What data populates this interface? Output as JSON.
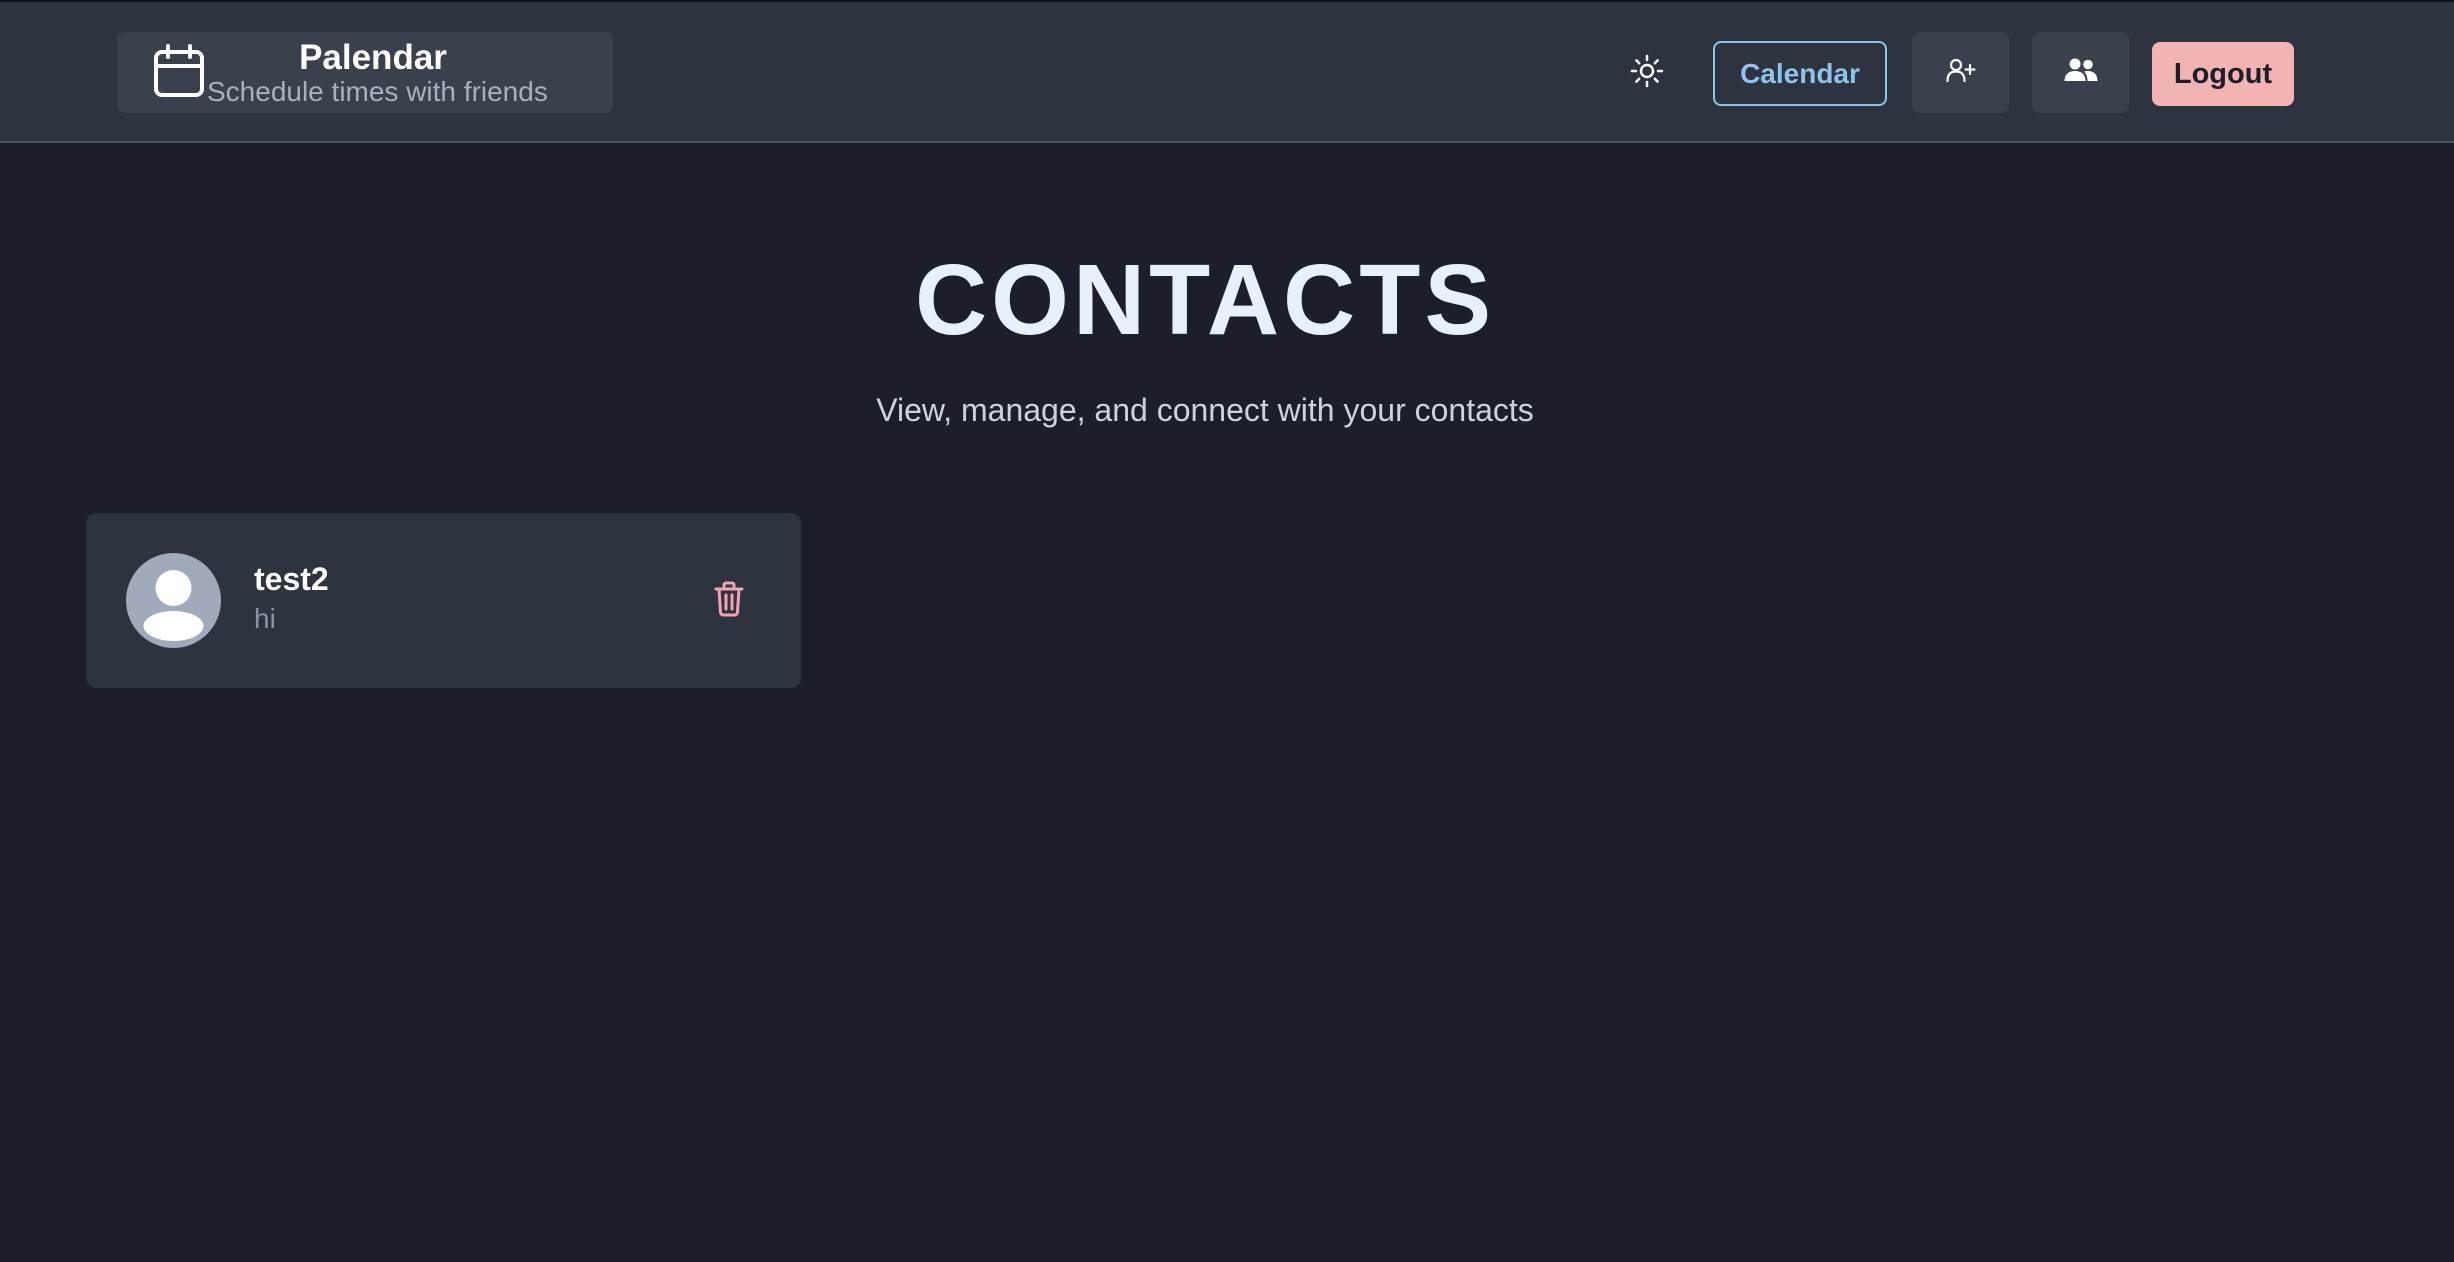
{
  "header": {
    "brand_icon": "calendar-icon",
    "app_name": "Palendar",
    "tagline": "Schedule times with friends",
    "theme_toggle_icon": "sun-icon",
    "calendar_label": "Calendar",
    "add_contact_icon": "user-plus-icon",
    "contacts_icon": "users-icon",
    "logout_label": "Logout"
  },
  "main": {
    "title": "CONTACTS",
    "subtitle": "View, manage, and connect with your contacts"
  },
  "contacts": [
    {
      "name": "test2",
      "status": "hi",
      "avatar_icon": "user-avatar-icon",
      "delete_icon": "trash-icon"
    }
  ],
  "colors": {
    "background": "#1c1f29",
    "header": "#2e3340",
    "accent": "#8ec3ea",
    "logout": "#f2b3b3",
    "delete": "#f2a5b0"
  }
}
